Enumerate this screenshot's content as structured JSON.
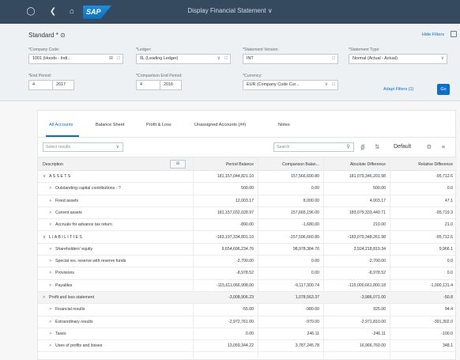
{
  "shell": {
    "app_title": "Display Financial Statement ∨",
    "logo": "SAP",
    "home_icon": "home-icon",
    "back_icon": "back-icon"
  },
  "header": {
    "variant": "Standard * ⊙",
    "hide_filters": "Hide Filters",
    "filters": [
      {
        "label": "*Company Code:",
        "value": "1001 (Hoods - Indi...",
        "icon": "value-help-icon",
        "icon2": "clear-icon"
      },
      {
        "label": "*Ledger:",
        "value": "0L (Leading Ledger)",
        "icon": "value-help-icon",
        "icon2": "dropdown-icon"
      },
      {
        "label": "*Statement Version:",
        "value": "INT",
        "icon": "value-help-icon"
      },
      {
        "label": "*Statement Type:",
        "value": "Normal (Actual - Actual)",
        "icon": "dropdown-icon"
      },
      {
        "label": "*End Period:",
        "value_a": "4",
        "value_b": "2017"
      },
      {
        "label": "*Comparison End Period:",
        "value_a": "4",
        "value_b": "2016"
      },
      {
        "label": "*Currency:",
        "value": "EUR (Company Code Cur...",
        "icon": "dropdown-icon",
        "icon2": "value-help-icon"
      }
    ],
    "adapt_filters": "Adapt Filters (1)",
    "go": "Go"
  },
  "tabs": [
    {
      "label": "All Accounts",
      "active": true
    },
    {
      "label": "Balance Sheet"
    },
    {
      "label": "Profit & Loss"
    },
    {
      "label": "Unassigned Accounts (##)"
    },
    {
      "label": "Notes"
    }
  ],
  "toolbar": {
    "filter_placeholder": "Select results",
    "search_placeholder": "Search",
    "default_label": "Default",
    "icons": [
      "search-icon",
      "filter-icon",
      "sort-icon",
      "settings-icon",
      "export-icon"
    ]
  },
  "table": {
    "columns": [
      "Description",
      "Period Balance",
      "Comparison Balan...",
      "Absolute Difference",
      "Relative Difference"
    ],
    "column_button": "⊞ ",
    "rows": [
      {
        "indent": 0,
        "chev": "∨",
        "desc": "A S S E T S",
        "c1": "181,157,044,821.10",
        "c2": "157,566,600.80",
        "c3": "181,079,346,201.98",
        "c4": "-95,712.6"
      },
      {
        "indent": 1,
        "chev": ">",
        "desc": "Outstanding capital contributions - ?",
        "c1": "500.00",
        "c2": "0.00",
        "c3": "500.00",
        "c4": "0.0"
      },
      {
        "indent": 1,
        "chev": ">",
        "desc": "Fixed assets",
        "c1": "12,003.17",
        "c2": "8,000.00",
        "c3": "4,003.17",
        "c4": "47.1"
      },
      {
        "indent": 1,
        "chev": ">",
        "desc": "Current assets",
        "c1": "181,157,032,028.97",
        "c2": "157,665,196.00",
        "c3": "183,079,333,440.71",
        "c4": "-95,719.3"
      },
      {
        "indent": 1,
        "chev": ">",
        "desc": "Accruals for advance tax return",
        "c1": "-890.00",
        "c2": "-1,680.00",
        "c3": "210.00",
        "c4": "21.0"
      },
      {
        "indent": 0,
        "chev": "∨",
        "desc": "L I A B I L I T I E S",
        "c1": "-183,197,334,801.10",
        "c2": "-157,596,660.80",
        "c3": "-183,079,348,261.98",
        "c4": "-95,712.6"
      },
      {
        "indent": 1,
        "chev": ">",
        "desc": "Shareholders' equity",
        "c1": "9,654,606,234.76",
        "c2": "98,978,384.76",
        "c3": "3,924,218,819.34",
        "c4": "9,966.1"
      },
      {
        "indent": 1,
        "chev": ">",
        "desc": "Special res. reserve with reserve funds",
        "c1": "-2,700.00",
        "c2": "0.00",
        "c3": "-2,700.00",
        "c4": "0.0"
      },
      {
        "indent": 1,
        "chev": ">",
        "desc": "Provisions",
        "c1": "-8,978.52",
        "c2": "0.00",
        "c3": "-8,978.52",
        "c4": "0.0"
      },
      {
        "indent": 1,
        "chev": ">",
        "desc": "Payables",
        "c1": "-115,611,066,908.00",
        "c2": "-9,117,300.74",
        "c3": "-115,000,661,800.18",
        "c4": "-1,000,131.4"
      },
      {
        "indent": 0,
        "chev": ">",
        "desc": "Profit and loss statement",
        "c1": "-3,008,906.23",
        "c2": "1,078,563.37",
        "c3": "-3,986,071.00",
        "c4": "-50.8",
        "highlight": true
      },
      {
        "indent": 1,
        "chev": ">",
        "desc": "Financial results",
        "c1": "-55.00",
        "c2": "-980.00",
        "c3": "925.00",
        "c4": "94.4"
      },
      {
        "indent": 1,
        "chev": ">",
        "desc": "Extraordinary results",
        "c1": "-2,972,761.00",
        "c2": "-970.00",
        "c3": "-2,971,810.00",
        "c4": "-391,302.0"
      },
      {
        "indent": 1,
        "chev": ">",
        "desc": "Taxes",
        "c1": "0.00",
        "c2": "246.11",
        "c3": "-246.11",
        "c4": "-100.0"
      },
      {
        "indent": 1,
        "chev": ">",
        "desc": "Uses of profits and losses",
        "c1": "13,059,344.22",
        "c2": "3,787,245.78",
        "c3": "16,966,760.00",
        "c4": "348.1"
      }
    ]
  },
  "colors": {
    "shell": "#354a5f",
    "accent": "#0a6ed1",
    "header_bg": "#eef1f4"
  }
}
